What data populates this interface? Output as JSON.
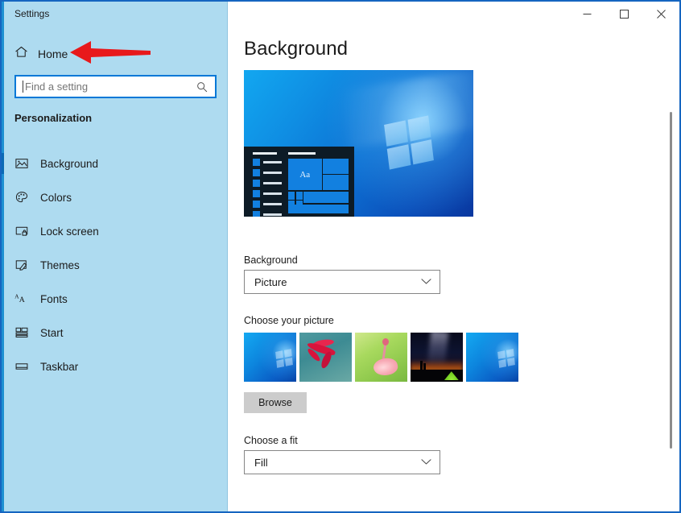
{
  "window": {
    "title": "Settings",
    "controls": {
      "minimize": "minimize",
      "maximize": "maximize",
      "close": "close"
    }
  },
  "sidebar": {
    "home": {
      "label": "Home",
      "icon": "home-icon"
    },
    "search": {
      "value": "",
      "placeholder": "Find a setting",
      "icon": "search-icon"
    },
    "section_title": "Personalization",
    "items": [
      {
        "label": "Background",
        "icon": "picture-icon",
        "selected": true
      },
      {
        "label": "Colors",
        "icon": "palette-icon",
        "selected": false
      },
      {
        "label": "Lock screen",
        "icon": "lock-screen-icon",
        "selected": false
      },
      {
        "label": "Themes",
        "icon": "themes-brush-icon",
        "selected": false
      },
      {
        "label": "Fonts",
        "icon": "fonts-aa-icon",
        "selected": false
      },
      {
        "label": "Start",
        "icon": "start-tiles-icon",
        "selected": false
      },
      {
        "label": "Taskbar",
        "icon": "taskbar-icon",
        "selected": false
      }
    ]
  },
  "main": {
    "page_title": "Background",
    "preview": {
      "name": "desktop-preview",
      "start_menu_tile_text": "Aa"
    },
    "background_label": "Background",
    "background_value": "Picture",
    "picture_label": "Choose your picture",
    "thumbnails": [
      {
        "name": "windows-default-wallpaper",
        "selected": true
      },
      {
        "name": "red-flower-wallpaper",
        "selected": false
      },
      {
        "name": "pink-flower-wallpaper",
        "selected": false
      },
      {
        "name": "night-sky-tent-wallpaper",
        "selected": false
      },
      {
        "name": "windows-default-wallpaper-2",
        "selected": false
      }
    ],
    "browse_label": "Browse",
    "fit_label": "Choose a fit",
    "fit_value": "Fill"
  },
  "annotation": {
    "arrow_color": "#e8191b",
    "points_to": "Home"
  },
  "colors": {
    "sidebar_bg": "#aedbf0",
    "accent": "#0078d7",
    "window_border": "#1565c0",
    "selection_bar": "#0b6ab5"
  }
}
